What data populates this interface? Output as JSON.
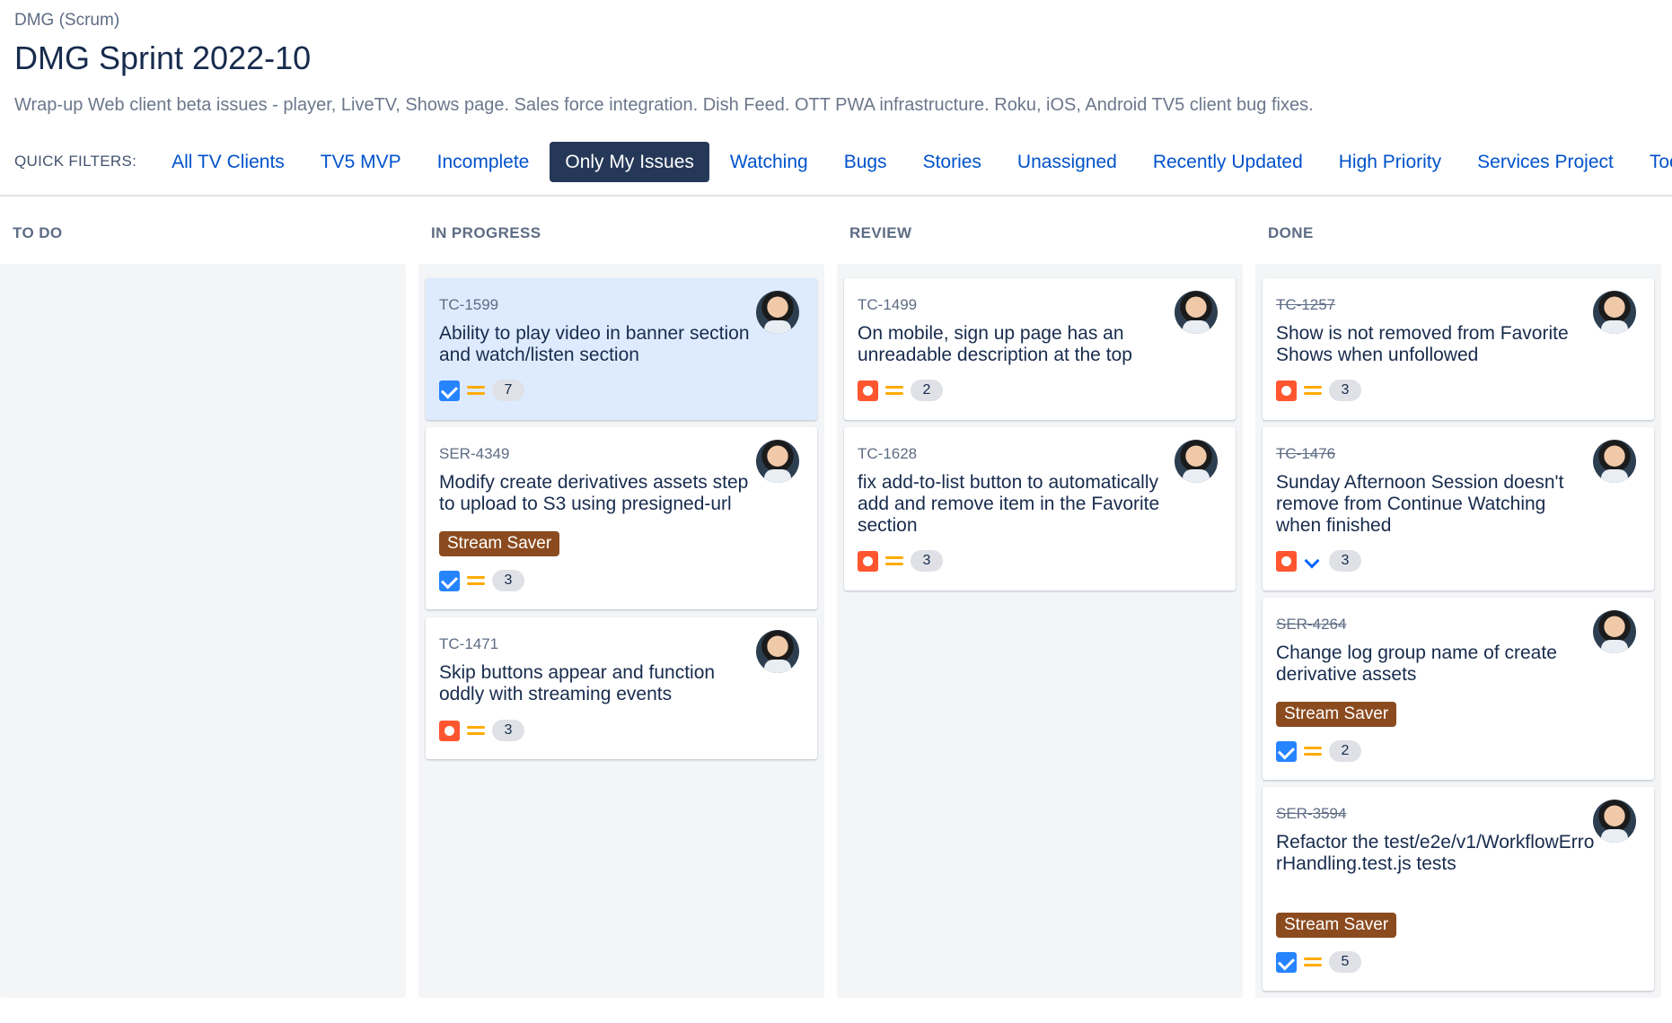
{
  "header": {
    "project": "DMG (Scrum)",
    "sprint_title": "DMG Sprint 2022-10",
    "sprint_goal": "Wrap-up Web client beta issues - player, LiveTV, Shows page. Sales force integration. Dish Feed. OTT PWA infrastructure. Roku, iOS, Android TV5 client bug fixes."
  },
  "quick_filters": {
    "label": "QUICK FILTERS:",
    "items": [
      "All TV Clients",
      "TV5 MVP",
      "Incomplete",
      "Only My Issues",
      "Watching",
      "Bugs",
      "Stories",
      "Unassigned",
      "Recently Updated",
      "High Priority",
      "Services Project",
      "Tools P"
    ],
    "active": "Only My Issues"
  },
  "columns": [
    {
      "name": "TO DO",
      "cards": []
    },
    {
      "name": "IN PROGRESS",
      "cards": [
        {
          "key": "TC-1599",
          "summary": "Ability to play video in banner section and watch/listen section",
          "type": "task",
          "priority": "medium",
          "points": "7",
          "selected": true
        },
        {
          "key": "SER-4349",
          "summary": "Modify create derivatives assets step to upload to S3 using presigned-url",
          "epic": "Stream Saver",
          "type": "task",
          "priority": "medium",
          "points": "3"
        },
        {
          "key": "TC-1471",
          "summary": "Skip buttons appear and function oddly with streaming events",
          "type": "bug",
          "priority": "medium",
          "points": "3"
        }
      ]
    },
    {
      "name": "REVIEW",
      "cards": [
        {
          "key": "TC-1499",
          "summary": "On mobile, sign up page has an unreadable description at the top",
          "type": "bug",
          "priority": "medium",
          "points": "2"
        },
        {
          "key": "TC-1628",
          "summary": "fix add-to-list button to automatically add and remove item in the Favorite section",
          "type": "bug",
          "priority": "medium",
          "points": "3"
        }
      ]
    },
    {
      "name": "DONE",
      "cards": [
        {
          "key": "TC-1257",
          "summary": "Show is not removed from Favorite Shows when unfollowed",
          "type": "bug",
          "priority": "medium",
          "points": "3",
          "done": true
        },
        {
          "key": "TC-1476",
          "summary": "Sunday Afternoon Session doesn't remove from Continue Watching when finished",
          "type": "bug",
          "priority": "low",
          "points": "3",
          "done": true
        },
        {
          "key": "SER-4264",
          "summary": "Change log group name of create derivative assets",
          "epic": "Stream Saver",
          "type": "task",
          "priority": "medium",
          "points": "2",
          "done": true
        },
        {
          "key": "SER-3594",
          "summary": "Refactor the test/e2e/v1/WorkflowErrorHandling.test.js tests",
          "epic": "Stream Saver",
          "type": "task",
          "priority": "medium",
          "points": "5",
          "done": true
        }
      ]
    }
  ],
  "colors": {
    "link": "#0052cc",
    "active_filter_bg": "#253858",
    "epic_stream_saver": "#8b4b1f",
    "task_icon": "#2684ff",
    "bug_icon": "#ff5630",
    "priority_medium": "#ffab00",
    "priority_low": "#0065ff",
    "selected_card": "#deebff"
  }
}
